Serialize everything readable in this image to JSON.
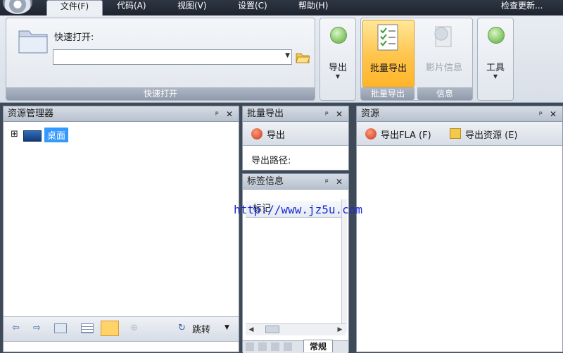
{
  "menu": {
    "file": "文件(F)",
    "code": "代码(A)",
    "view": "视图(V)",
    "settings": "设置(C)",
    "help": "帮助(H)",
    "update": "检查更新..."
  },
  "ribbon": {
    "quick_open_label": "快速打开:",
    "quick_open_value": "",
    "group_quick_open": "快速打开",
    "export_btn": "导出",
    "batch_export_btn": "批量导出",
    "movie_info_btn": "影片信息",
    "tools_btn": "工具",
    "group_batch_export": "批量导出",
    "group_info": "信息"
  },
  "explorer": {
    "title": "资源管理器",
    "tree_expander": "⊞",
    "tree_root": "桌面",
    "goto_label": "跳转"
  },
  "batch_panel": {
    "title": "批量导出",
    "export_label": "导出",
    "export_path_label": "导出路径:"
  },
  "tag_panel": {
    "title": "标签信息",
    "column_header": "标记",
    "tab_label": "常规"
  },
  "resource_panel": {
    "title": "资源",
    "export_fla": "导出FLA (F)",
    "export_resources": "导出资源 (E)"
  },
  "watermark": "http://www.jz5u.com",
  "panel_controls": {
    "pin": "ᵖ",
    "close": "✕"
  },
  "colors": {
    "title_bar": "#1e2530",
    "accent": "#ffc44a",
    "selection": "#3399ff"
  }
}
